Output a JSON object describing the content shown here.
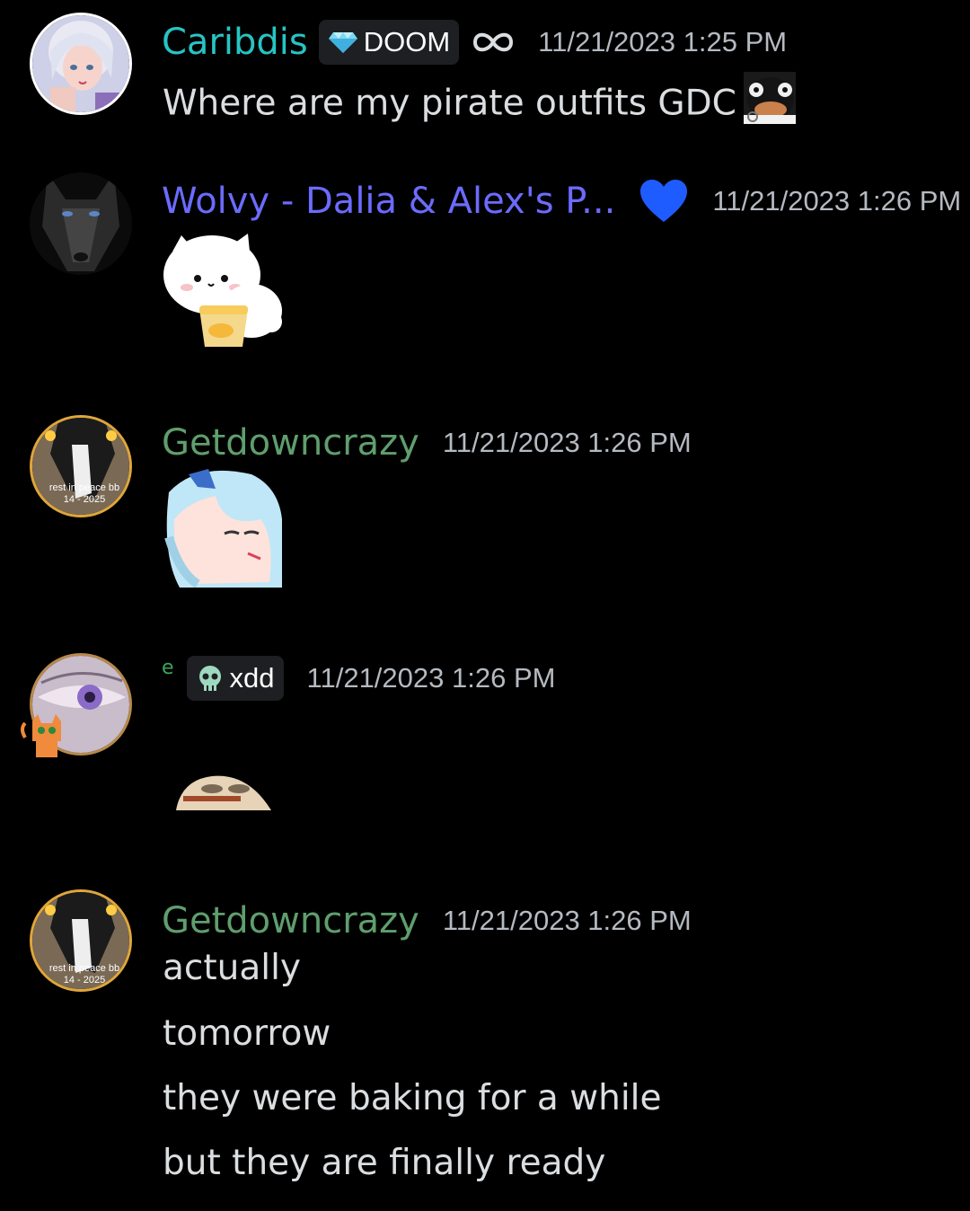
{
  "messages": [
    {
      "username": "Caribdis",
      "username_color": "#27c4c4",
      "tag": {
        "icon": "diamond-icon",
        "label": "DOOM"
      },
      "extra_icon": "infinity-icon",
      "timestamp": "11/21/2023 1:25 PM",
      "lines": [
        "Where are my pirate outfits GDC"
      ],
      "inline_emoji": "pingu-emoji"
    },
    {
      "username": "Wolvy - Dalia & Alex's P...",
      "username_color": "#6b6bff",
      "extra_icon": "blue-heart-icon",
      "timestamp": "11/21/2023 1:26 PM",
      "sticker": "cat-eating-chips-sticker"
    },
    {
      "username": "Getdowncrazy",
      "username_color": "#5f9e6e",
      "timestamp": "11/21/2023 1:26 PM",
      "sticker": "anime-girl-sticker",
      "avatar_text": [
        "rest in peace bb",
        "14 - 2025"
      ]
    },
    {
      "username": "e",
      "username_color": "#3ba55c",
      "tag": {
        "icon": "skull-icon",
        "label": "xdd"
      },
      "timestamp": "11/21/2023 1:26 PM",
      "sticker": "peeking-emote-sticker"
    },
    {
      "username": "Getdowncrazy",
      "username_color": "#5f9e6e",
      "timestamp": "11/21/2023 1:26 PM",
      "avatar_text": [
        "rest in peace bb",
        "14 - 2025"
      ],
      "lines": [
        "actually",
        "tomorrow",
        "they were baking for a while",
        "but they are finally ready"
      ]
    }
  ]
}
